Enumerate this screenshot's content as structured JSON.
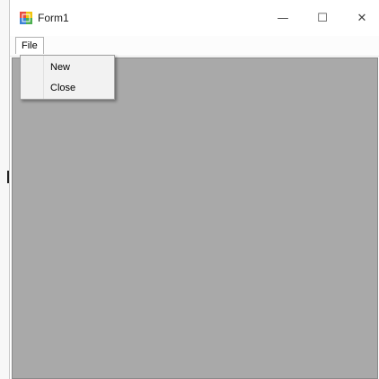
{
  "window": {
    "title": "Form1",
    "minimize_glyph": "—",
    "maximize_glyph": "☐",
    "close_glyph": "✕",
    "icon": "winforms-app-icon"
  },
  "menubar": {
    "items": [
      {
        "label": "File"
      }
    ]
  },
  "file_menu": {
    "items": [
      {
        "label": "New"
      },
      {
        "label": "Close"
      }
    ]
  },
  "colors": {
    "client_area": "#a9a9a9",
    "menu_background": "#f2f2f2"
  }
}
